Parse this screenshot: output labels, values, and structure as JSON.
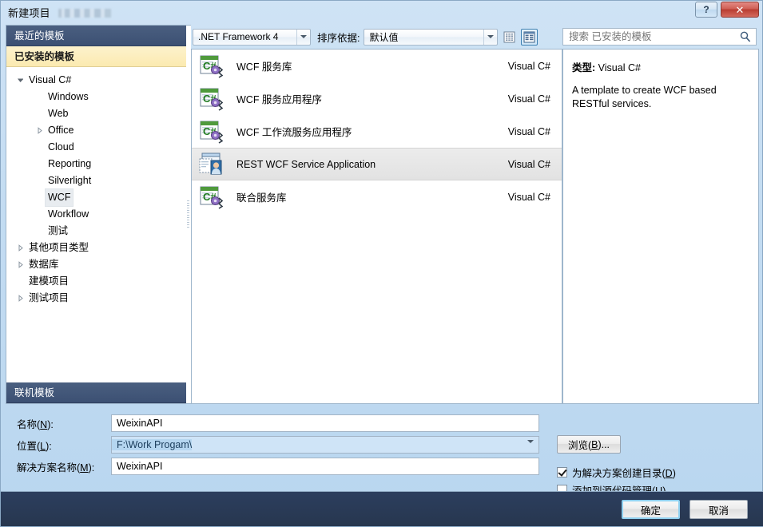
{
  "window": {
    "title": "新建项目",
    "help_label": "?",
    "close_label": "✕"
  },
  "sidebar": {
    "recent_header": "最近的模板",
    "installed_header": "已安装的模板",
    "online_header": "联机模板",
    "tree": [
      {
        "label": "Visual C#",
        "indent": 0,
        "expander": "down",
        "selected": false
      },
      {
        "label": "Windows",
        "indent": 1,
        "expander": "none",
        "selected": false
      },
      {
        "label": "Web",
        "indent": 1,
        "expander": "none",
        "selected": false
      },
      {
        "label": "Office",
        "indent": 1,
        "expander": "right",
        "selected": false
      },
      {
        "label": "Cloud",
        "indent": 1,
        "expander": "none",
        "selected": false
      },
      {
        "label": "Reporting",
        "indent": 1,
        "expander": "none",
        "selected": false
      },
      {
        "label": "Silverlight",
        "indent": 1,
        "expander": "none",
        "selected": false
      },
      {
        "label": "WCF",
        "indent": 1,
        "expander": "none",
        "selected": true
      },
      {
        "label": "Workflow",
        "indent": 1,
        "expander": "none",
        "selected": false
      },
      {
        "label": "测试",
        "indent": 1,
        "expander": "none",
        "selected": false
      },
      {
        "label": "其他项目类型",
        "indent": 0,
        "expander": "right",
        "selected": false
      },
      {
        "label": "数据库",
        "indent": 0,
        "expander": "right",
        "selected": false
      },
      {
        "label": "建模项目",
        "indent": 0,
        "expander": "none",
        "selected": false
      },
      {
        "label": "测试项目",
        "indent": 0,
        "expander": "right",
        "selected": false
      }
    ]
  },
  "toolbar": {
    "framework_value": ".NET Framework 4",
    "sortby_label": "排序依据:",
    "sort_value": "默认值",
    "view_small_icon": "small-icons-view-icon",
    "view_medium_icon": "medium-icons-view-icon",
    "view_selected": "medium"
  },
  "search": {
    "placeholder": "搜索 已安装的模板",
    "value": "",
    "icon": "search-icon"
  },
  "templates": [
    {
      "name": "WCF 服务库",
      "lang": "Visual C#",
      "icon": "csharp-wcf-icon",
      "selected": false
    },
    {
      "name": "WCF 服务应用程序",
      "lang": "Visual C#",
      "icon": "csharp-wcf-icon",
      "selected": false
    },
    {
      "name": "WCF 工作流服务应用程序",
      "lang": "Visual C#",
      "icon": "csharp-wcf-icon",
      "selected": false
    },
    {
      "name": "REST WCF Service Application",
      "lang": "Visual C#",
      "icon": "rest-wcf-icon",
      "selected": true
    },
    {
      "name": "联合服务库",
      "lang": "Visual C#",
      "icon": "csharp-wcf-icon",
      "selected": false
    }
  ],
  "description": {
    "type_label": "类型:",
    "type_value": "Visual C#",
    "body": "A template to create WCF based RESTful services."
  },
  "form": {
    "name_label": "名称(N):",
    "name_value": "WeixinAPI",
    "location_label": "位置(L):",
    "location_value": "F:\\Work Progam\\",
    "solution_label": "解决方案名称(M):",
    "solution_value": "WeixinAPI",
    "browse_label": "浏览(B)...",
    "create_dir_label": "为解决方案创建目录(D)",
    "create_dir_checked": true,
    "add_scc_label": "添加到源代码管理(U)",
    "add_scc_checked": false
  },
  "buttons": {
    "ok_label": "确定",
    "cancel_label": "取消"
  },
  "colors": {
    "dialog_bg": "#c3dcf2",
    "header_dark": "#3c5073",
    "header_active": "#fbeab0",
    "bottom_bar": "#2c3e5e",
    "close_red": "#b83c31",
    "selection_blue": "#b5d6f0"
  }
}
